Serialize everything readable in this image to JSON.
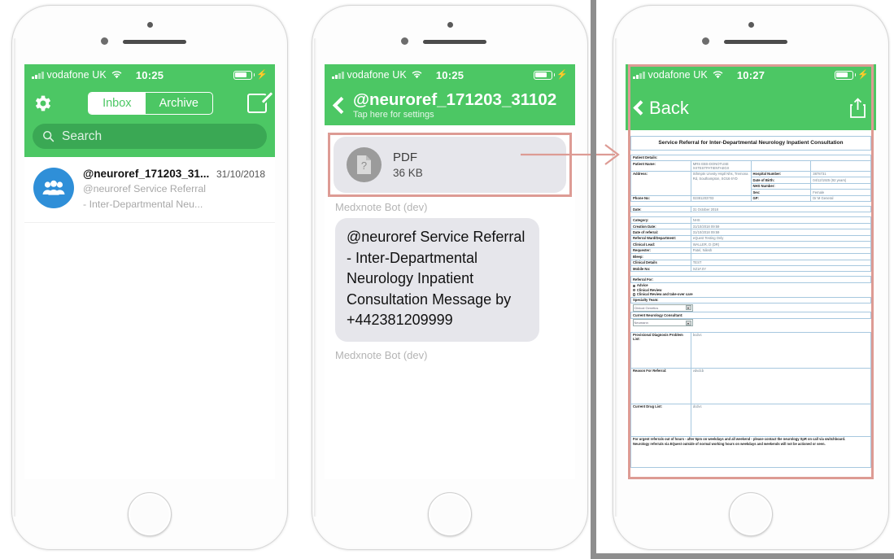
{
  "theme": {
    "accent_green": "#4cc764",
    "highlight_pink": "#dd9b94",
    "avatar_blue": "#2f8fd8"
  },
  "phone1": {
    "status": {
      "carrier": "vodafone UK",
      "time": "10:25",
      "wifi_icon": "wifi-icon",
      "signal_icon": "signal-bars-icon",
      "battery_icon": "battery-icon",
      "charging_icon": "charging-bolt-icon"
    },
    "nav": {
      "gear_icon": "gear-icon",
      "compose_icon": "compose-icon",
      "segments": [
        {
          "label": "Inbox",
          "active": true
        },
        {
          "label": "Archive",
          "active": false
        }
      ]
    },
    "search": {
      "placeholder": "Search",
      "icon": "search-icon"
    },
    "conversation": {
      "avatar_icon": "group-avatar-icon",
      "title": "@neuroref_171203_31...",
      "date": "31/10/2018",
      "snippet_line1": "@neuroref Service Referral",
      "snippet_line2": "- Inter-Departmental Neu..."
    }
  },
  "phone2": {
    "status": {
      "carrier": "vodafone UK",
      "time": "10:25"
    },
    "nav": {
      "back_icon": "back-chevron-icon",
      "title": "@neuroref_171203_31102…",
      "subtitle": "Tap here for settings"
    },
    "attachment": {
      "icon": "pdf-file-icon",
      "type": "PDF",
      "size": "36 KB",
      "highlighted": true
    },
    "sender_label_1": "Medxnote Bot (dev)",
    "message": "@neuroref Service Referral - Inter-Departmental Neurology Inpatient Consultation  Message by +442381209999",
    "sender_label_2": "Medxnote Bot (dev)"
  },
  "phone3": {
    "status": {
      "carrier": "vodafone UK",
      "time": "10:27"
    },
    "nav": {
      "back_icon": "back-chevron-icon",
      "back_label": "Back",
      "share_icon": "share-icon"
    },
    "document": {
      "title": "Service Referral for Inter-Departmental Neurology Inpatient Consultation",
      "section_patient": "Patient Details:",
      "rows": [
        {
          "label": "Patient Name:",
          "value": "MRS EBS-DONOTUSE XXTESTPATIENTAEGX"
        },
        {
          "label": "Address:",
          "value": "Sthmptn Unvsty Hsptl Nhs, Tremona Rd, Southampton, SO16 6YD"
        },
        {
          "label": "Phone No:",
          "value": "02381203703"
        },
        {
          "label": "Date:",
          "value": "31 October 2018"
        }
      ],
      "right_rows": [
        {
          "label": "Hospital Number:",
          "value": "3878731"
        },
        {
          "label": "Date of Birth:",
          "value": "04/12/1925 (92 years)"
        },
        {
          "label": "NHS Number:",
          "value": ""
        },
        {
          "label": "Sex:",
          "value": "Female"
        },
        {
          "label": "GP:",
          "value": "Dr M General"
        }
      ],
      "detail_rows": [
        {
          "label": "Category:",
          "value": "NHS"
        },
        {
          "label": "Creation Date:",
          "value": "31/10/2018 09:59"
        },
        {
          "label": "Date of referral:",
          "value": "31/10/2018 09:59"
        },
        {
          "label": "Referral Ward/Department:",
          "value": "eQuest Testing Only"
        },
        {
          "label": "Clinical Lead:",
          "value": "WALLER, D (DR)"
        },
        {
          "label": "Requester:",
          "value": "Patel, Nilesh"
        },
        {
          "label": "Bleep:",
          "value": ""
        },
        {
          "label": "Clinical Details",
          "value": "TEST"
        },
        {
          "label": "Mobile No:",
          "value": "XZ1#.0Y"
        }
      ],
      "referral_for_label": "Referral For:",
      "referral_options": [
        {
          "label": "Advice",
          "selected": true
        },
        {
          "label": "Clinical Review",
          "selected": false
        },
        {
          "label": "Clinical Review and take-over care",
          "selected": false
        }
      ],
      "specialty_team_label": "Specialty Team:",
      "specialty_team_value": "Clinical Genetics",
      "consultant_label": "Current Neurology Consultant:",
      "consultant_value": "Neumann",
      "text_rows": [
        {
          "label": "Provisional Diagnosis Problem List:",
          "value": "bcdvc"
        },
        {
          "label": "Reason For Referral:",
          "value": "vdvdcb"
        },
        {
          "label": "Current Drug List:",
          "value": "dcdvc"
        }
      ],
      "footer_line1": "For urgent referrals out of hours - after 5pm on weekdays and all weekend - please contact the neurology SpR on call via switchboard.",
      "footer_line2": "Neurology referrals via EQuest outside of normal working hours on weekdays and weekends will not be actioned or seen."
    }
  },
  "connector": {
    "arrow_icon": "flow-arrow-icon"
  }
}
